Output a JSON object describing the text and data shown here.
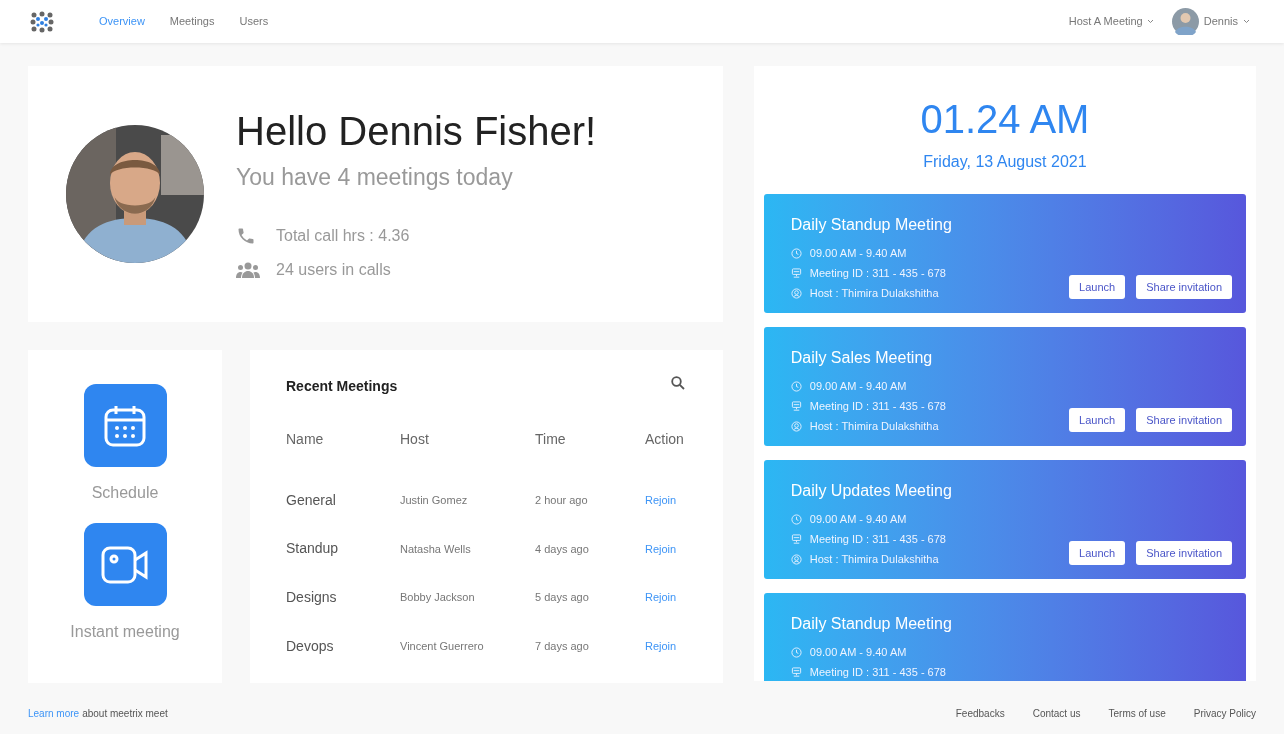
{
  "nav": {
    "tabs": [
      {
        "label": "Overview",
        "selected": true
      },
      {
        "label": "Meetings",
        "selected": false
      },
      {
        "label": "Users",
        "selected": false
      }
    ],
    "host_menu": "Host A Meeting",
    "user_menu": "Dennis"
  },
  "greeting": {
    "title": "Hello Dennis Fisher!",
    "subtitle": "You have 4 meetings today",
    "stats": [
      {
        "kind": "phone",
        "text": "Total call hrs : 4.36"
      },
      {
        "kind": "users",
        "text": "24 users in calls"
      }
    ]
  },
  "actions": [
    {
      "kind": "calendar",
      "label": "Schedule"
    },
    {
      "kind": "video",
      "label": "Instant meeting"
    }
  ],
  "recent": {
    "title": "Recent Meetings",
    "columns": [
      "Name",
      "Host",
      "Time",
      "Action"
    ],
    "rows": [
      {
        "name": "General",
        "host": "Justin Gomez",
        "time": "2 hour ago",
        "action": "Rejoin"
      },
      {
        "name": "Standup",
        "host": "Natasha Wells",
        "time": "4 days ago",
        "action": "Rejoin"
      },
      {
        "name": "Designs",
        "host": "Bobby Jackson",
        "time": "5 days ago",
        "action": "Rejoin"
      },
      {
        "name": "Devops",
        "host": "Vincent Guerrero",
        "time": "7 days ago",
        "action": "Rejoin"
      }
    ]
  },
  "clock": {
    "time": "01.24 AM",
    "date": "Friday, 13 August 2021"
  },
  "meetings": [
    {
      "title": "Daily Standup Meeting",
      "time": "09.00 AM - 9.40 AM",
      "meeting_id": "Meeting ID : 311 - 435 - 678",
      "host": "Host : Thimira Dulakshitha",
      "buttons": [
        "Launch",
        "Share invitation"
      ]
    },
    {
      "title": "Daily Sales Meeting",
      "time": "09.00 AM - 9.40 AM",
      "meeting_id": "Meeting ID : 311 - 435 - 678",
      "host": "Host : Thimira Dulakshitha",
      "buttons": [
        "Launch",
        "Share invitation"
      ]
    },
    {
      "title": "Daily Updates Meeting",
      "time": "09.00 AM - 9.40 AM",
      "meeting_id": "Meeting ID : 311 - 435 - 678",
      "host": "Host : Thimira Dulakshitha",
      "buttons": [
        "Launch",
        "Share invitation"
      ]
    },
    {
      "title": "Daily Standup Meeting",
      "time": "09.00 AM - 9.40 AM",
      "meeting_id": "Meeting ID : 311 - 435 - 678"
    }
  ],
  "footer": {
    "link": "Learn more",
    "text": "about meetrix meet",
    "links": [
      "Feedbacks",
      "Contact us",
      "Terms of use",
      "Privacy Policy"
    ]
  }
}
